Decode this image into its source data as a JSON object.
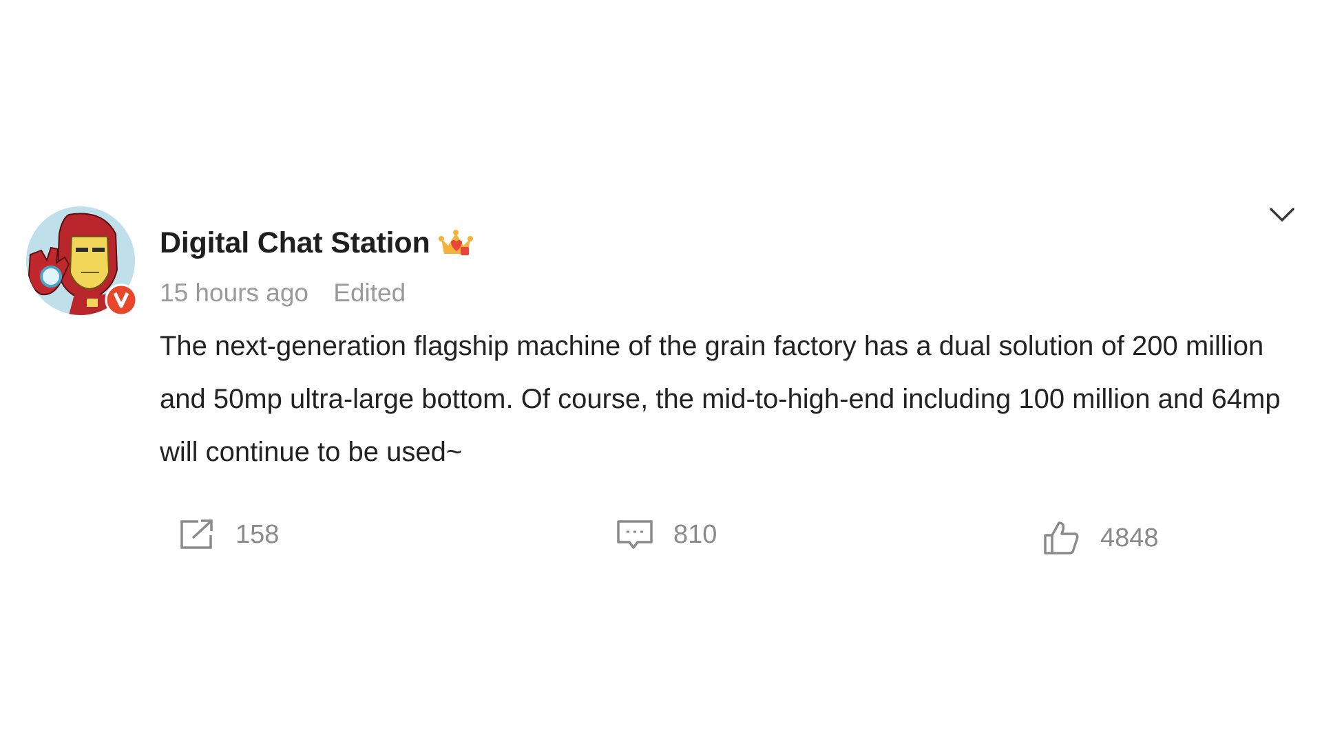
{
  "post": {
    "author": {
      "name": "Digital Chat Station",
      "verified_badge_letter": "V",
      "vip_badge_icon": "crown-icon"
    },
    "meta": {
      "time": "15 hours ago",
      "edited": "Edited"
    },
    "text": "The next-generation flagship machine of the grain factory has a dual solution of 200 million and 50mp ultra-large bottom. Of course, the mid-to-high-end including 100 million and 64mp will continue to be used~",
    "actions": {
      "repost_count": "158",
      "comment_count": "810",
      "like_count": "4848"
    }
  },
  "colors": {
    "verified": "#e8472b",
    "vip": "#f3b23a",
    "icon_gray": "#8a8a8a"
  },
  "icons": [
    "chevron-down-icon",
    "repost-icon",
    "comment-icon",
    "thumbs-up-icon",
    "crown-icon"
  ]
}
